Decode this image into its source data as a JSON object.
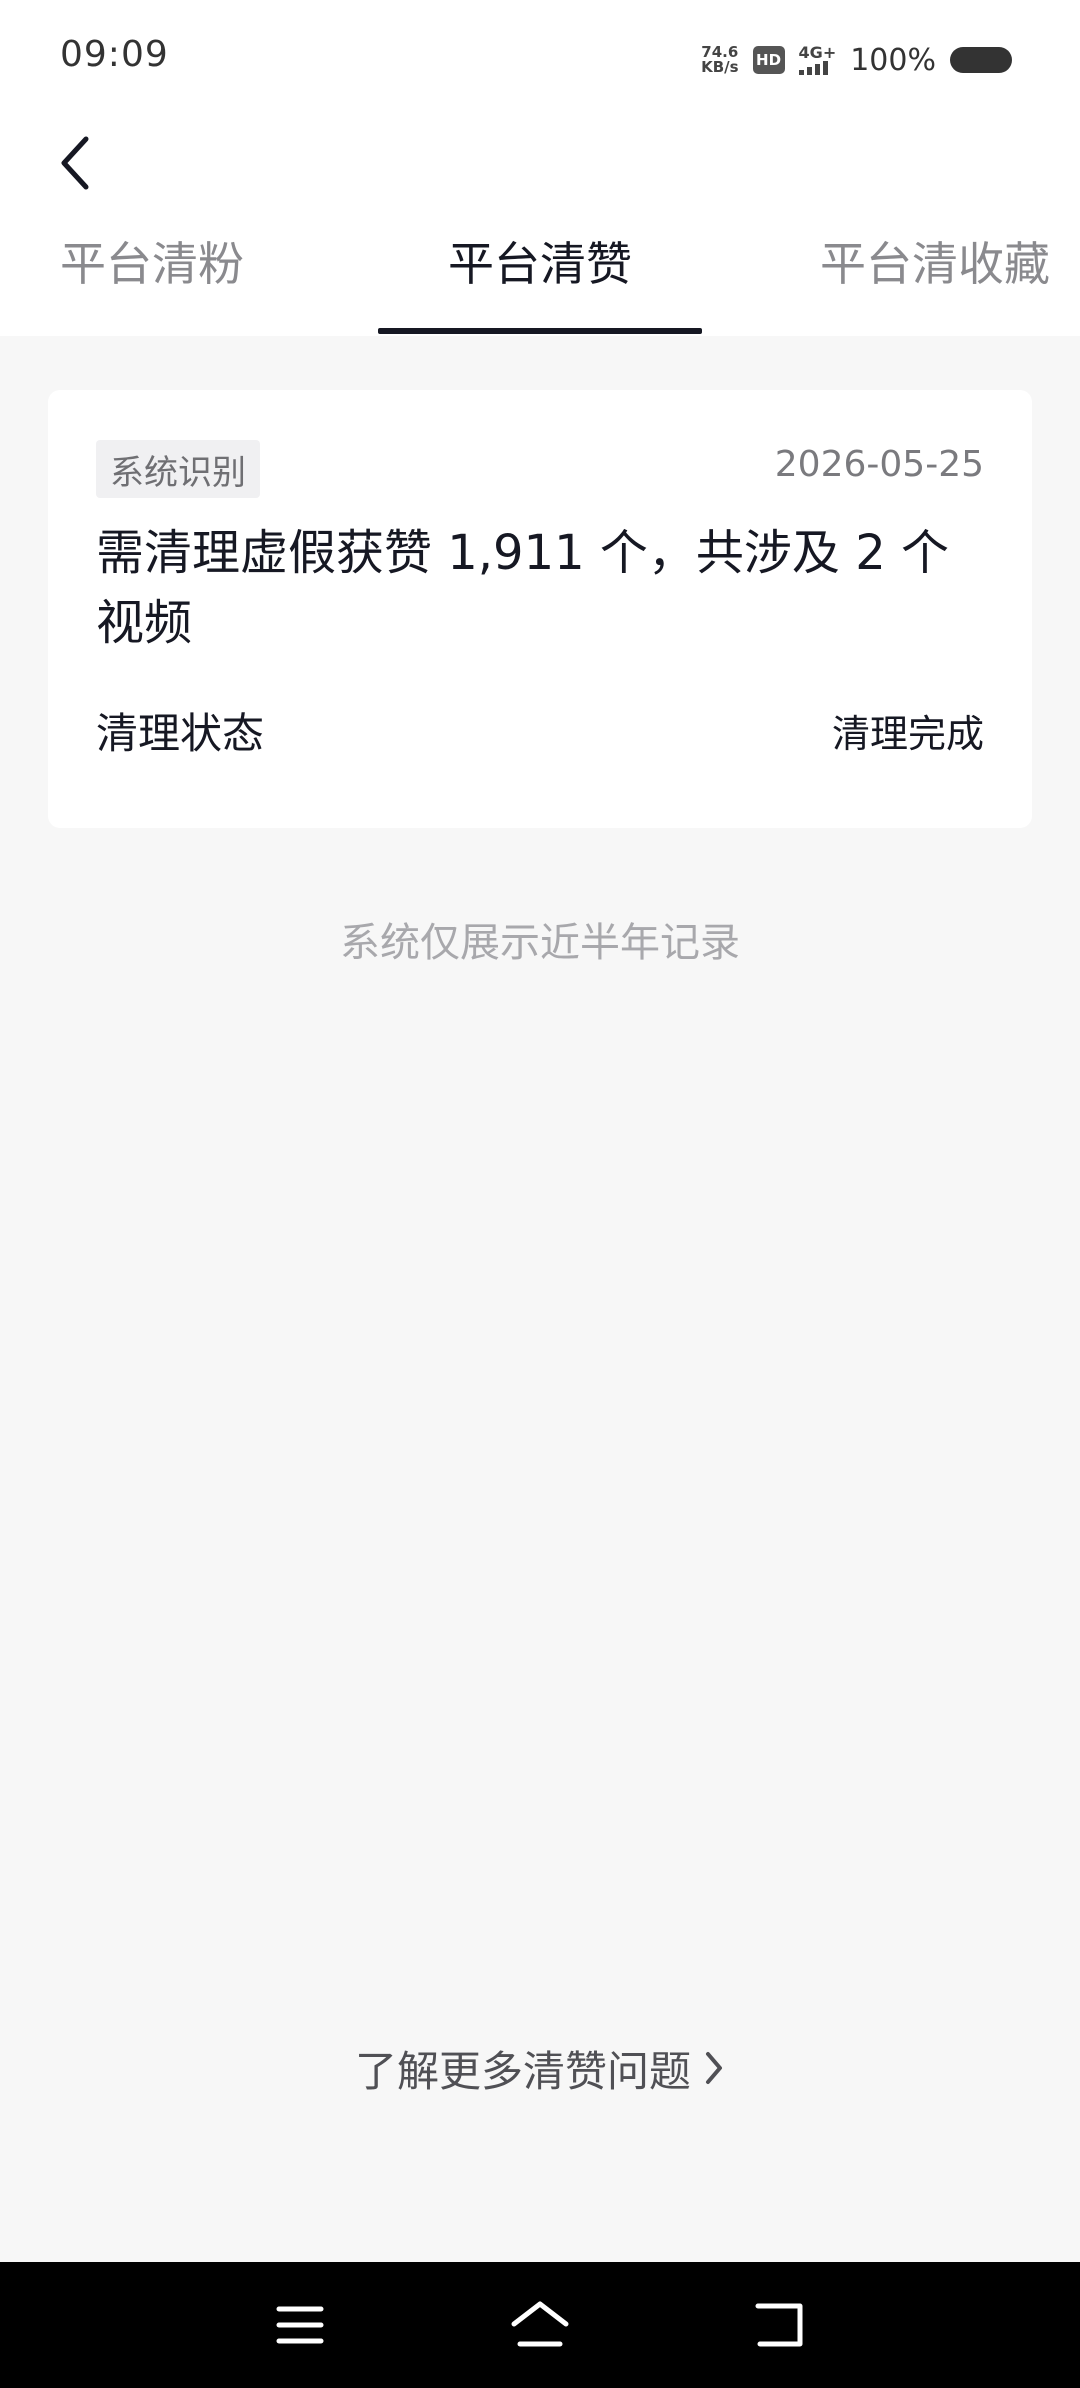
{
  "status_bar": {
    "time": "09:09",
    "net_speed_value": "74.6",
    "net_speed_unit": "KB/s",
    "hd_badge": "HD",
    "signal": "4G+",
    "battery_percent": "100%"
  },
  "header": {
    "tabs": [
      {
        "label": "平台清粉",
        "active": false
      },
      {
        "label": "平台清赞",
        "active": true
      },
      {
        "label": "平台清收藏",
        "active": false
      }
    ]
  },
  "record": {
    "source_tag": "系统识别",
    "date": "2026-05-25",
    "title": "需清理虚假获赞 1,911 个，共涉及 2 个视频",
    "status_label": "清理状态",
    "status_value": "清理完成"
  },
  "notice": "系统仅展示近半年记录",
  "footer": {
    "learn_more": "了解更多清赞问题"
  },
  "colors": {
    "primary_text": "#161823",
    "secondary_text": "#8a8a8e",
    "background": "#f7f7f7",
    "card": "#ffffff"
  }
}
